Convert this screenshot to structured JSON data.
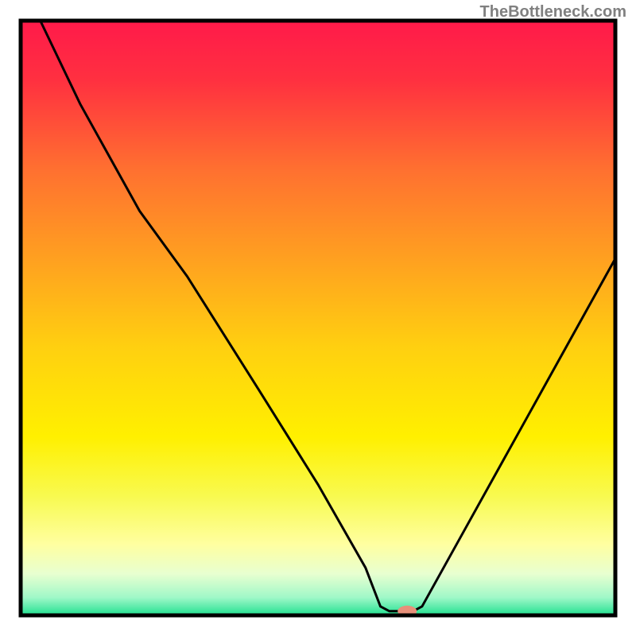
{
  "watermark": "TheBottleneck.com",
  "chart_data": {
    "type": "line",
    "title": "",
    "xlabel": "",
    "ylabel": "",
    "xlim": [
      0,
      100
    ],
    "ylim": [
      0,
      100
    ],
    "background": {
      "type": "vertical-gradient",
      "stops": [
        {
          "offset": 0.0,
          "color": "#ff1a4a"
        },
        {
          "offset": 0.1,
          "color": "#ff3040"
        },
        {
          "offset": 0.25,
          "color": "#ff7030"
        },
        {
          "offset": 0.4,
          "color": "#ffa020"
        },
        {
          "offset": 0.55,
          "color": "#ffd010"
        },
        {
          "offset": 0.7,
          "color": "#fff000"
        },
        {
          "offset": 0.8,
          "color": "#f8fa50"
        },
        {
          "offset": 0.88,
          "color": "#ffffa0"
        },
        {
          "offset": 0.93,
          "color": "#e8ffd0"
        },
        {
          "offset": 0.97,
          "color": "#a0f8c8"
        },
        {
          "offset": 1.0,
          "color": "#20e090"
        }
      ]
    },
    "curve": {
      "description": "V-shaped bottleneck curve",
      "points": [
        {
          "x": 3.3,
          "y": 100
        },
        {
          "x": 10,
          "y": 86
        },
        {
          "x": 20,
          "y": 68
        },
        {
          "x": 28,
          "y": 57
        },
        {
          "x": 40,
          "y": 38
        },
        {
          "x": 50,
          "y": 22
        },
        {
          "x": 58,
          "y": 8
        },
        {
          "x": 60.5,
          "y": 1.5
        },
        {
          "x": 62,
          "y": 0.7
        },
        {
          "x": 66,
          "y": 0.7
        },
        {
          "x": 67.5,
          "y": 1.5
        },
        {
          "x": 75,
          "y": 15
        },
        {
          "x": 85,
          "y": 33
        },
        {
          "x": 95,
          "y": 51
        },
        {
          "x": 100,
          "y": 60
        }
      ]
    },
    "marker": {
      "x": 65,
      "y": 0.7,
      "color": "#e8907a",
      "rx": 12,
      "ry": 7
    },
    "frame": {
      "color": "#000000",
      "width": 3
    }
  }
}
